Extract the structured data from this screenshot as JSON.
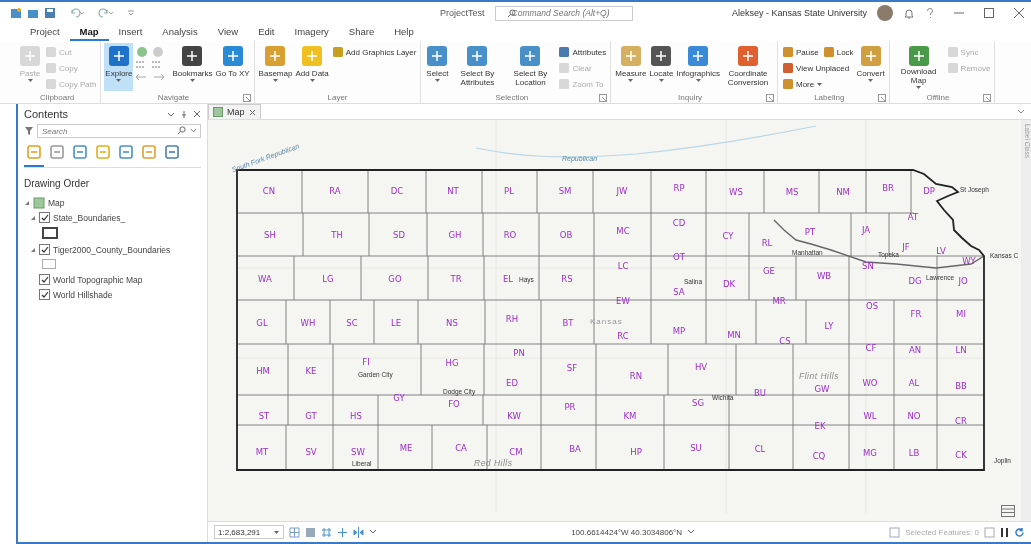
{
  "window": {
    "title": "ProjectTest",
    "command_search": {
      "placeholder": "Command Search (Alt+Q)"
    },
    "user": "Aleksey - Kansas State University"
  },
  "tabs": [
    {
      "label": "Project",
      "selected": false
    },
    {
      "label": "Map",
      "selected": true
    },
    {
      "label": "Insert",
      "selected": false
    },
    {
      "label": "Analysis",
      "selected": false
    },
    {
      "label": "View",
      "selected": false
    },
    {
      "label": "Edit",
      "selected": false
    },
    {
      "label": "Imagery",
      "selected": false
    },
    {
      "label": "Share",
      "selected": false
    },
    {
      "label": "Help",
      "selected": false
    }
  ],
  "ribbon": [
    {
      "name": "Clipboard",
      "launcher": false,
      "tools": [
        {
          "label": "Paste",
          "kind": "large",
          "disabled": true,
          "dropdown": true,
          "active": false
        },
        {
          "label": "Cut",
          "kind": "small",
          "disabled": true,
          "dropdown": false,
          "active": false
        },
        {
          "label": "Copy",
          "kind": "small",
          "disabled": true,
          "dropdown": false,
          "active": false
        },
        {
          "label": "Copy Path",
          "kind": "small",
          "disabled": true,
          "dropdown": false,
          "active": false
        }
      ]
    },
    {
      "name": "Navigate",
      "launcher": true,
      "tools": [
        {
          "label": "Explore",
          "kind": "large",
          "disabled": false,
          "dropdown": true,
          "active": true
        },
        {
          "kind": "icon-grid"
        },
        {
          "label": "Bookmarks",
          "kind": "large",
          "disabled": false,
          "dropdown": true,
          "active": false
        },
        {
          "label": "Go To XY",
          "kind": "large",
          "disabled": false,
          "dropdown": false,
          "active": false
        }
      ]
    },
    {
      "name": "Layer",
      "launcher": false,
      "tools": [
        {
          "label": "Basemap",
          "kind": "large",
          "disabled": false,
          "dropdown": true,
          "active": false
        },
        {
          "label": "Add Data",
          "kind": "large",
          "disabled": false,
          "dropdown": true,
          "active": false
        },
        {
          "label": "Add Graphics Layer",
          "kind": "small",
          "disabled": false,
          "dropdown": false,
          "active": false
        }
      ]
    },
    {
      "name": "Selection",
      "launcher": true,
      "tools": [
        {
          "label": "Select",
          "kind": "large",
          "disabled": false,
          "dropdown": true,
          "active": false
        },
        {
          "label": "Select By Attributes",
          "kind": "large",
          "disabled": false,
          "dropdown": false,
          "active": false
        },
        {
          "label": "Select By Location",
          "kind": "large",
          "disabled": false,
          "dropdown": false,
          "active": false
        },
        {
          "label": "Attributes",
          "kind": "small",
          "disabled": false,
          "dropdown": false,
          "active": false
        },
        {
          "label": "Clear",
          "kind": "small",
          "disabled": true,
          "dropdown": false,
          "active": false
        },
        {
          "label": "Zoom To",
          "kind": "small",
          "disabled": true,
          "dropdown": false,
          "active": false
        }
      ]
    },
    {
      "name": "Inquiry",
      "launcher": true,
      "tools": [
        {
          "label": "Measure",
          "kind": "large",
          "disabled": false,
          "dropdown": true,
          "active": false
        },
        {
          "label": "Locate",
          "kind": "large",
          "disabled": false,
          "dropdown": true,
          "active": false
        },
        {
          "label": "Infographics",
          "kind": "large",
          "disabled": false,
          "dropdown": true,
          "active": false
        },
        {
          "label": "Coordinate Conversion",
          "kind": "large",
          "disabled": false,
          "dropdown": false,
          "active": false
        }
      ]
    },
    {
      "name": "Labeling",
      "launcher": true,
      "tools": [
        {
          "label": "Pause",
          "kind": "small",
          "disabled": false,
          "dropdown": false,
          "active": false
        },
        {
          "label": "Lock",
          "kind": "small",
          "disabled": false,
          "dropdown": false,
          "active": false,
          "same_row": true
        },
        {
          "label": "View Unplaced",
          "kind": "small",
          "disabled": false,
          "dropdown": false,
          "active": false
        },
        {
          "label": "More",
          "kind": "small",
          "disabled": false,
          "dropdown": true,
          "active": false
        },
        {
          "label": "Convert",
          "kind": "large",
          "disabled": false,
          "dropdown": true,
          "active": false
        }
      ]
    },
    {
      "name": "Offline",
      "launcher": true,
      "tools": [
        {
          "label": "Download Map",
          "kind": "large",
          "disabled": false,
          "dropdown": true,
          "active": false
        },
        {
          "label": "Sync",
          "kind": "small",
          "disabled": true,
          "dropdown": false,
          "active": false
        },
        {
          "label": "Remove",
          "kind": "small",
          "disabled": true,
          "dropdown": false,
          "active": false
        }
      ]
    }
  ],
  "contents": {
    "title": "Contents",
    "search": {
      "placeholder": "Search"
    },
    "view_tabs": [
      {
        "selected": true
      },
      {
        "selected": false
      },
      {
        "selected": false
      },
      {
        "selected": false
      },
      {
        "selected": false
      },
      {
        "selected": false
      },
      {
        "selected": false
      }
    ],
    "heading": "Drawing Order",
    "layers": [
      {
        "name": "Map",
        "expanded": true,
        "children": [
          {
            "name": "State_Boundaries_",
            "checked": true,
            "expanded": true,
            "bold_outline": true
          },
          {
            "name": "Tiger2000_County_Boundaries",
            "checked": true,
            "expanded": true,
            "bold_outline": false
          },
          {
            "name": "World Topographic Map",
            "checked": true,
            "expanded": false
          },
          {
            "name": "World Hillshade",
            "checked": true,
            "expanded": false
          }
        ]
      }
    ]
  },
  "map_view": {
    "tab": "Map",
    "side_tab": "Label Class",
    "counties": [
      "CN",
      "RA",
      "DC",
      "NT",
      "PL",
      "SM",
      "JW",
      "RP",
      "WS",
      "MS",
      "NM",
      "BR",
      "DP",
      "SH",
      "TH",
      "SD",
      "GH",
      "RO",
      "OB",
      "MC",
      "CD",
      "CY",
      "RL",
      "PT",
      "JA",
      "AT",
      "WA",
      "LG",
      "GO",
      "TR",
      "EL",
      "RS",
      "LC",
      "OT",
      "GE",
      "WB",
      "SN",
      "JF",
      "LV",
      "WY",
      "DG",
      "JO",
      "SA",
      "DK",
      "EW",
      "MR",
      "GL",
      "WH",
      "SC",
      "LE",
      "NS",
      "RH",
      "BT",
      "RC",
      "MP",
      "MN",
      "CS",
      "LY",
      "OS",
      "FR",
      "MI",
      "HM",
      "KE",
      "FI",
      "HG",
      "PN",
      "SF",
      "RN",
      "HV",
      "CF",
      "AN",
      "LN",
      "ED",
      "GY",
      "FO",
      "GW",
      "WO",
      "AL",
      "BB",
      "BU",
      "SG",
      "ST",
      "GT",
      "HS",
      "KW",
      "PR",
      "KM",
      "WL",
      "NO",
      "CR",
      "EK",
      "MT",
      "SV",
      "SW",
      "ME",
      "CA",
      "CM",
      "BA",
      "HP",
      "SU",
      "CL",
      "CQ",
      "MG",
      "LB",
      "CK"
    ],
    "places": [
      {
        "name": "Republican",
        "kind": "river"
      },
      {
        "name": "South Fork Republican",
        "kind": "river"
      },
      {
        "name": "St Joseph",
        "kind": "city"
      },
      {
        "name": "Manhattan",
        "kind": "city"
      },
      {
        "name": "Topeka",
        "kind": "city"
      },
      {
        "name": "Kansas C",
        "kind": "city"
      },
      {
        "name": "Hays",
        "kind": "city"
      },
      {
        "name": "Salina",
        "kind": "city"
      },
      {
        "name": "Lawrence",
        "kind": "city"
      },
      {
        "name": "Kansas",
        "kind": "state"
      },
      {
        "name": "Garden City",
        "kind": "city"
      },
      {
        "name": "Flint Hills",
        "kind": "region"
      },
      {
        "name": "Dodge City",
        "kind": "city"
      },
      {
        "name": "Wichita",
        "kind": "city"
      },
      {
        "name": "Liberal",
        "kind": "city"
      },
      {
        "name": "Red Hills",
        "kind": "region"
      },
      {
        "name": "Joplin",
        "kind": "city"
      }
    ]
  },
  "status_bar": {
    "scale": "1:2,683,291",
    "coordinates": "100.6614424°W 40.3034806°N",
    "selected_features": "Selected Features: 0"
  }
}
